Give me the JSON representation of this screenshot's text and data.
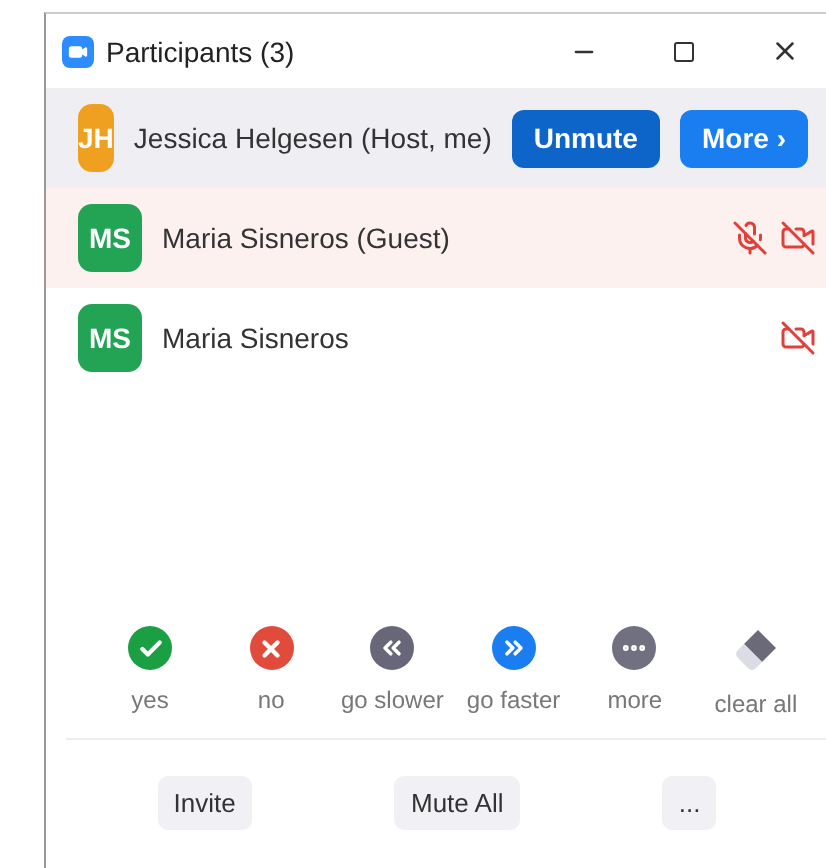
{
  "window": {
    "title": "Participants (3)"
  },
  "participants": [
    {
      "initials": "JH",
      "color": "#f0a020",
      "name": "Jessica Helgesen (Host, me)",
      "hovered": true,
      "highlighted": false,
      "mic_muted": false,
      "video_off": false,
      "actions": [
        "Unmute",
        "More ›"
      ]
    },
    {
      "initials": "MS",
      "color": "#23a455",
      "name": "Maria Sisneros (Guest)",
      "hovered": false,
      "highlighted": true,
      "mic_muted": true,
      "video_off": true
    },
    {
      "initials": "MS",
      "color": "#23a455",
      "name": "Maria Sisneros",
      "hovered": false,
      "highlighted": false,
      "mic_muted": false,
      "video_off": true
    }
  ],
  "reactions": [
    {
      "kind": "yes",
      "label": "yes"
    },
    {
      "kind": "no",
      "label": "no"
    },
    {
      "kind": "slower",
      "label": "go slower"
    },
    {
      "kind": "faster",
      "label": "go faster"
    },
    {
      "kind": "more",
      "label": "more"
    },
    {
      "kind": "clear",
      "label": "clear all"
    }
  ],
  "footer_buttons": [
    "Invite",
    "Mute All",
    "..."
  ]
}
